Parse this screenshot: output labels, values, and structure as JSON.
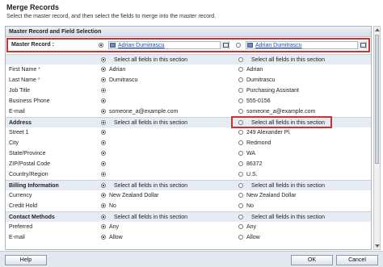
{
  "dialog": {
    "title": "Merge Records",
    "subtitle": "Select the master record, and then select the fields to merge into the master record."
  },
  "panel": {
    "header": "Master Record and Field Selection"
  },
  "master": {
    "label": "Master Record :",
    "left_record": "Adrian Dumitrascu",
    "right_record": "Adrian Dumitrascu"
  },
  "select_all_label": "Select all fields in this section",
  "rows": [
    {
      "type": "section",
      "label": "",
      "left": "Select all fields in this section",
      "right": "Select all fields in this section"
    },
    {
      "type": "field",
      "label": "First Name",
      "required": true,
      "left": "Adrian",
      "right": "Adrian"
    },
    {
      "type": "field",
      "label": "Last Name",
      "required": true,
      "left": "Dumitrascu",
      "right": "Dumitrascu"
    },
    {
      "type": "field",
      "label": "Job Title",
      "required": false,
      "left": "",
      "right": "Purchasing Assistant"
    },
    {
      "type": "field",
      "label": "Business Phone",
      "required": false,
      "left": "",
      "right": "555-0156"
    },
    {
      "type": "field",
      "label": "E-mail",
      "required": false,
      "left": "someone_a@example.com",
      "right": "someone_a@example.com"
    },
    {
      "type": "section",
      "label": "Address",
      "left": "Select all fields in this section",
      "right": "Select all fields in this section"
    },
    {
      "type": "field",
      "label": "Street 1",
      "required": false,
      "left": "",
      "right": "249 Alexander Pl."
    },
    {
      "type": "field",
      "label": "City",
      "required": false,
      "left": "",
      "right": "Redmond"
    },
    {
      "type": "field",
      "label": "State/Province",
      "required": false,
      "left": "",
      "right": "WA"
    },
    {
      "type": "field",
      "label": "ZIP/Postal Code",
      "required": false,
      "left": "",
      "right": "86372"
    },
    {
      "type": "field",
      "label": "Country/Region",
      "required": false,
      "left": "",
      "right": "U.S."
    },
    {
      "type": "section",
      "label": "Billing Information",
      "left": "Select all fields in this section",
      "right": "Select all fields in this section"
    },
    {
      "type": "field",
      "label": "Currency",
      "required": false,
      "left": "New Zealand Dollar",
      "right": "New Zealand Dollar"
    },
    {
      "type": "field",
      "label": "Credit Hold",
      "required": false,
      "left": "No",
      "right": "No"
    },
    {
      "type": "section",
      "label": "Contact Methods",
      "left": "Select all fields in this section",
      "right": "Select all fields in this section"
    },
    {
      "type": "field",
      "label": "Preferred",
      "required": false,
      "left": "Any",
      "right": "Any"
    },
    {
      "type": "field",
      "label": "E-mail",
      "required": false,
      "left": "Allow",
      "right": "Allow"
    }
  ],
  "buttons": {
    "help": "Help",
    "ok": "OK",
    "cancel": "Cancel"
  },
  "colors": {
    "highlight": "#d03030",
    "link": "#1c4fa8"
  }
}
